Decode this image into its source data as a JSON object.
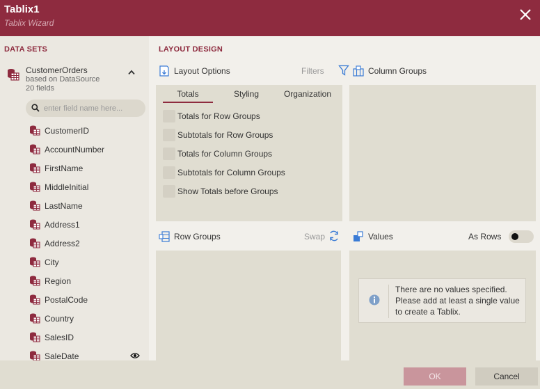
{
  "dialog": {
    "title": "Tablix1",
    "subtitle": "Tablix Wizard"
  },
  "datasets": {
    "section_label": "DATA SETS",
    "dataset": {
      "name": "CustomerOrders",
      "source": "based on DataSource",
      "field_count": "20 fields"
    },
    "search_placeholder": "enter field name here...",
    "fields": [
      "CustomerID",
      "AccountNumber",
      "FirstName",
      "MiddleInitial",
      "LastName",
      "Address1",
      "Address2",
      "City",
      "Region",
      "PostalCode",
      "Country",
      "SalesID",
      "SaleDate"
    ]
  },
  "layout": {
    "section_label": "LAYOUT DESIGN",
    "layout_options": {
      "label": "Layout Options",
      "filters_label": "Filters",
      "tabs": [
        "Totals",
        "Styling",
        "Organization"
      ],
      "active_tab": "Totals",
      "options": [
        "Totals for Row Groups",
        "Subtotals for Row Groups",
        "Totals for Column Groups",
        "Subtotals for Column Groups",
        "Show Totals before Groups"
      ]
    },
    "column_groups": {
      "label": "Column Groups"
    },
    "row_groups": {
      "label": "Row Groups",
      "swap_label": "Swap"
    },
    "values": {
      "label": "Values",
      "as_rows_label": "As Rows",
      "notice": "There are no values specified. Please add at least a single value to create a Tablix."
    }
  },
  "footer": {
    "ok_label": "OK",
    "cancel_label": "Cancel"
  },
  "colors": {
    "accent": "#8e2b3f",
    "panel_bg": "#e0ddd1",
    "icon_blue": "#3a7bd5"
  }
}
